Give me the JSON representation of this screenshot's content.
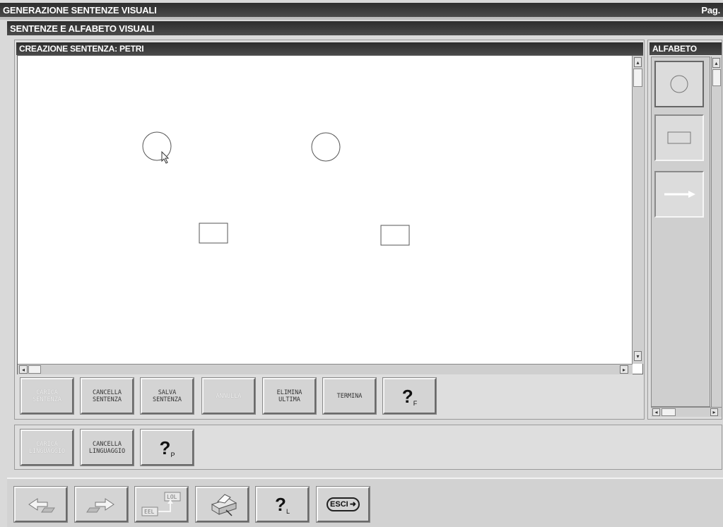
{
  "app_title": "GENERAZIONE SENTENZE VISUALI",
  "page_label": "Pag.",
  "section_title": "SENTENZE E ALFABETO VISUALI",
  "editor": {
    "title": "CREAZIONE SENTENZA: PETRI",
    "shapes": [
      "circle",
      "circle",
      "rectangle",
      "rectangle"
    ]
  },
  "alphabet": {
    "title": "ALFABETO",
    "items": [
      "circle-icon",
      "rectangle-icon",
      "arrow-icon"
    ]
  },
  "sentence_buttons": [
    {
      "label": "CARICA\nSENTENZA",
      "enabled": false
    },
    {
      "label": "CANCELLA\nSENTENZA",
      "enabled": true
    },
    {
      "label": "SALVA\nSENTENZA",
      "enabled": true
    },
    {
      "label": "ANNULLA",
      "enabled": false
    },
    {
      "label": "ELIMINA\nULTIMA",
      "enabled": true
    },
    {
      "label": "TERMINA",
      "enabled": true
    },
    {
      "label": "?",
      "sub": "F",
      "enabled": true
    }
  ],
  "language_buttons": [
    {
      "label": "CARICA\nLINGUAGGIO",
      "enabled": false
    },
    {
      "label": "CANCELLA\nLINGUAGGIO",
      "enabled": true
    },
    {
      "label": "?",
      "sub": "P",
      "enabled": true
    }
  ],
  "bottom_toolbar": {
    "icons": [
      "back-icon",
      "forward-icon",
      "lol-eel-icon",
      "printer-icon",
      "help-icon",
      "exit-icon"
    ],
    "help_sub": "L",
    "exit_label": "ESCI"
  }
}
